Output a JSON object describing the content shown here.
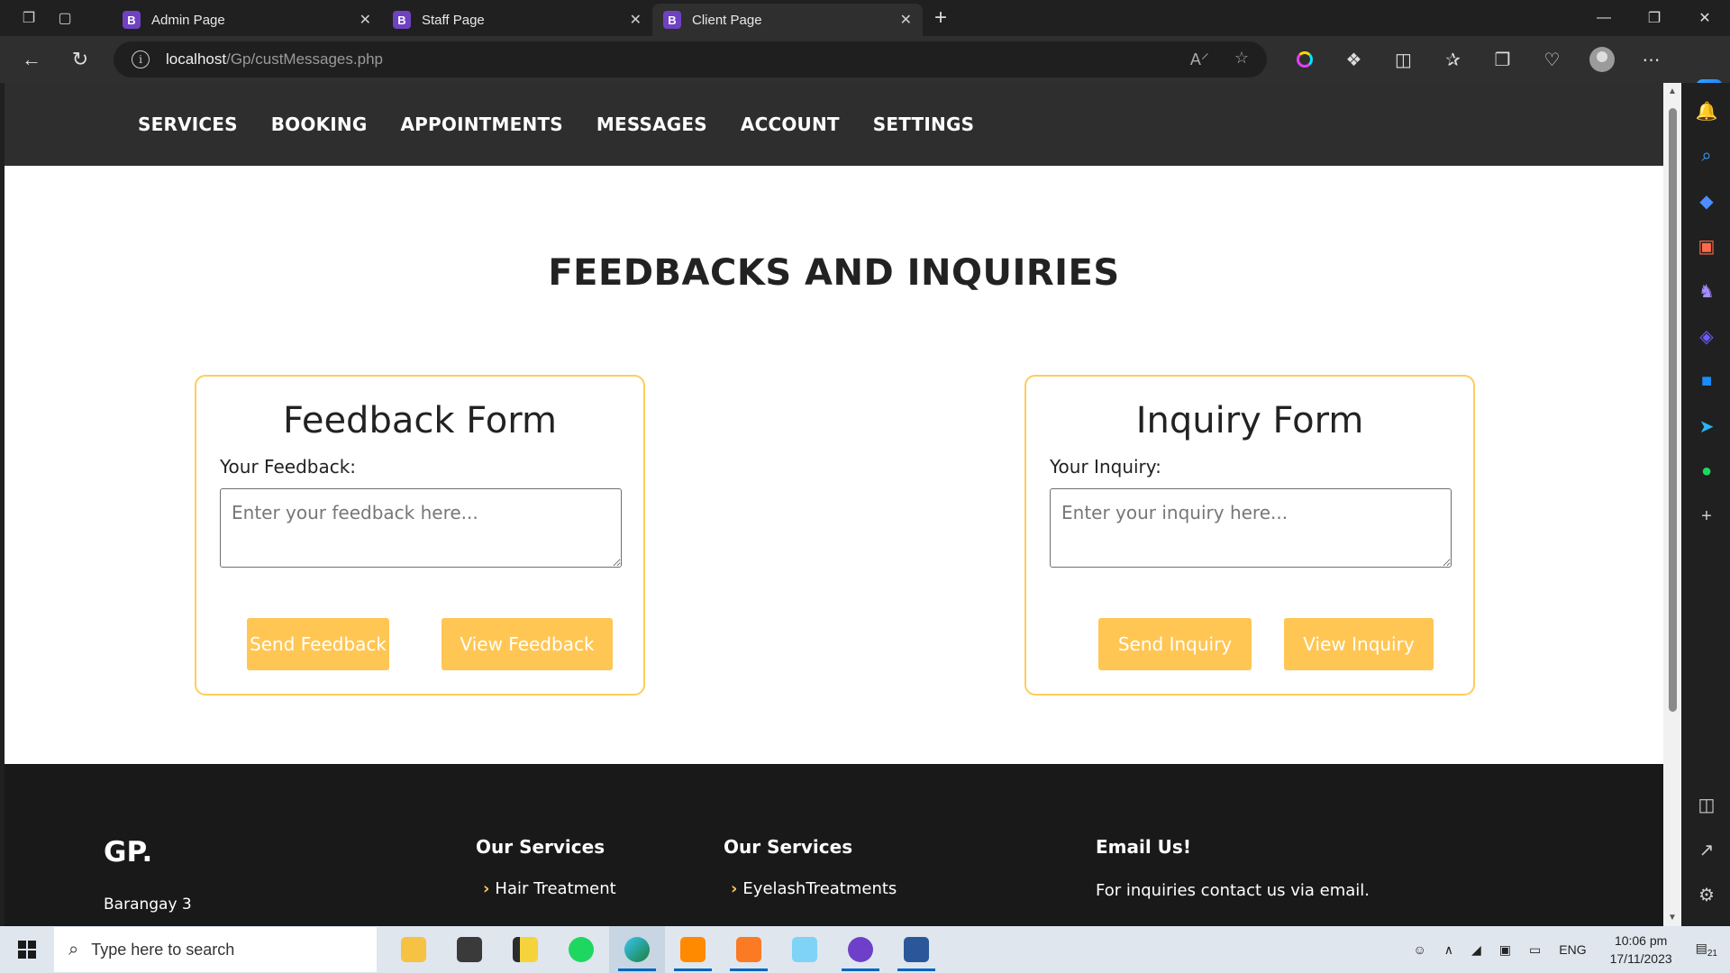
{
  "browser": {
    "tabs": [
      {
        "label": "Admin Page",
        "favicon": "B"
      },
      {
        "label": "Staff Page",
        "favicon": "B"
      },
      {
        "label": "Client Page",
        "favicon": "B",
        "active": true
      }
    ],
    "url_host": "localhost",
    "url_path": "/Gp/custMessages.php"
  },
  "site": {
    "nav": [
      "SERVICES",
      "BOOKING",
      "APPOINTMENTS",
      "MESSAGES",
      "ACCOUNT",
      "SETTINGS"
    ],
    "title": "FEEDBACKS AND INQUIRIES",
    "feedback": {
      "heading": "Feedback Form",
      "label": "Your Feedback:",
      "placeholder": "Enter your feedback here...",
      "send": "Send Feedback",
      "view": "View Feedback"
    },
    "inquiry": {
      "heading": "Inquiry Form",
      "label": "Your Inquiry:",
      "placeholder": "Enter your inquiry here...",
      "send": "Send Inquiry",
      "view": "View Inquiry"
    },
    "footer": {
      "logo": "GP.",
      "address": "Barangay 3",
      "col1_title": "Our Services",
      "col1_item": "Hair Treatment",
      "col2_title": "Our Services",
      "col2_item": "EyelashTreatments",
      "col3_title": "Email Us!",
      "col3_text": "For inquiries contact us via email."
    }
  },
  "taskbar": {
    "search_placeholder": "Type here to search",
    "lang": "ENG",
    "time": "10:06 pm",
    "date": "17/11/2023",
    "notifications": "21"
  },
  "colors": {
    "accent": "#ffc654",
    "card_border": "#ffcc5c",
    "nav_bg": "#2e2e2e",
    "footer_bg": "#191919"
  }
}
